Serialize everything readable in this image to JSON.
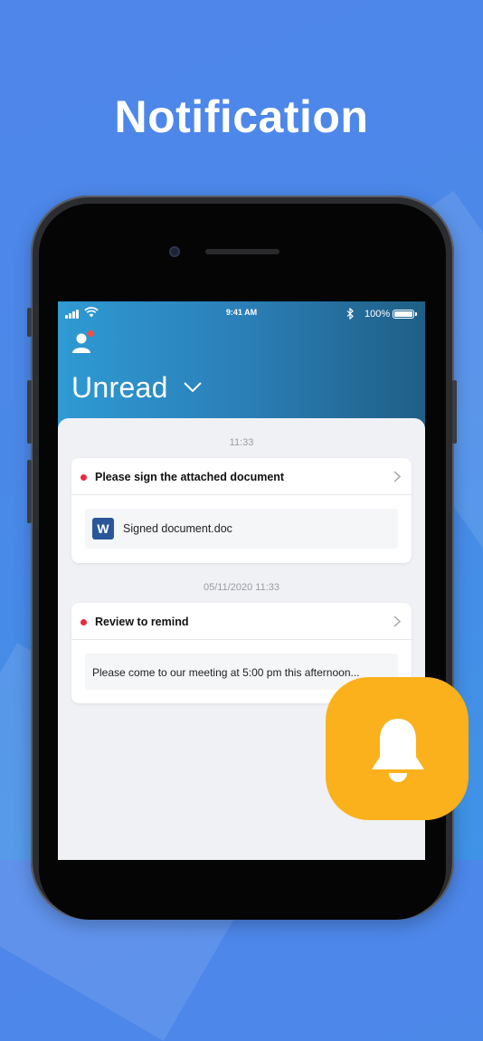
{
  "headline": "Notification",
  "status_bar": {
    "time": "9:41 AM",
    "battery": "100%"
  },
  "header": {
    "folder_title": "Unread"
  },
  "groups": [
    {
      "timestamp": "11:33",
      "title": "Please sign the attached document",
      "attachment": {
        "icon_letter": "W",
        "name": "Signed document.doc"
      }
    },
    {
      "timestamp": "05/11/2020 11:33",
      "title": "Review to remind",
      "message": "Please come to our meeting at 5:00 pm this afternoon..."
    }
  ],
  "colors": {
    "background": "#4a88e8",
    "unread_dot": "#e62c3f",
    "badge": "#fbb11c",
    "word_blue": "#2b579a"
  },
  "icons": [
    "wifi-icon",
    "bluetooth-icon",
    "avatar-icon",
    "chevron-down-icon",
    "chevron-right-icon",
    "word-icon",
    "bell-icon"
  ]
}
